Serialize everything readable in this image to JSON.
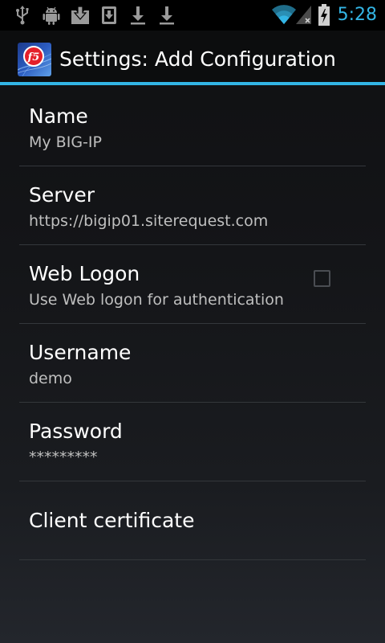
{
  "status_bar": {
    "time": "5:28",
    "notification_icons": [
      "usb-icon",
      "android-debug-icon",
      "download-done-icon",
      "sd-download-icon",
      "download-icon",
      "download-icon"
    ],
    "right_icons": [
      "wifi-icon",
      "signal-no-service-icon",
      "battery-charging-icon"
    ],
    "accent_color": "#33b5e5"
  },
  "action_bar": {
    "title": "Settings: Add Configuration",
    "icon": "f5-app-icon"
  },
  "preferences": {
    "name": {
      "title": "Name",
      "summary": "My BIG-IP"
    },
    "server": {
      "title": "Server",
      "summary": "https://bigip01.siterequest.com"
    },
    "web_logon": {
      "title": "Web Logon",
      "summary": "Use Web logon for authentication",
      "checked": false
    },
    "username": {
      "title": "Username",
      "summary": "demo"
    },
    "password": {
      "title": "Password",
      "summary": "*********"
    },
    "client_certificate": {
      "title": "Client certificate"
    }
  }
}
